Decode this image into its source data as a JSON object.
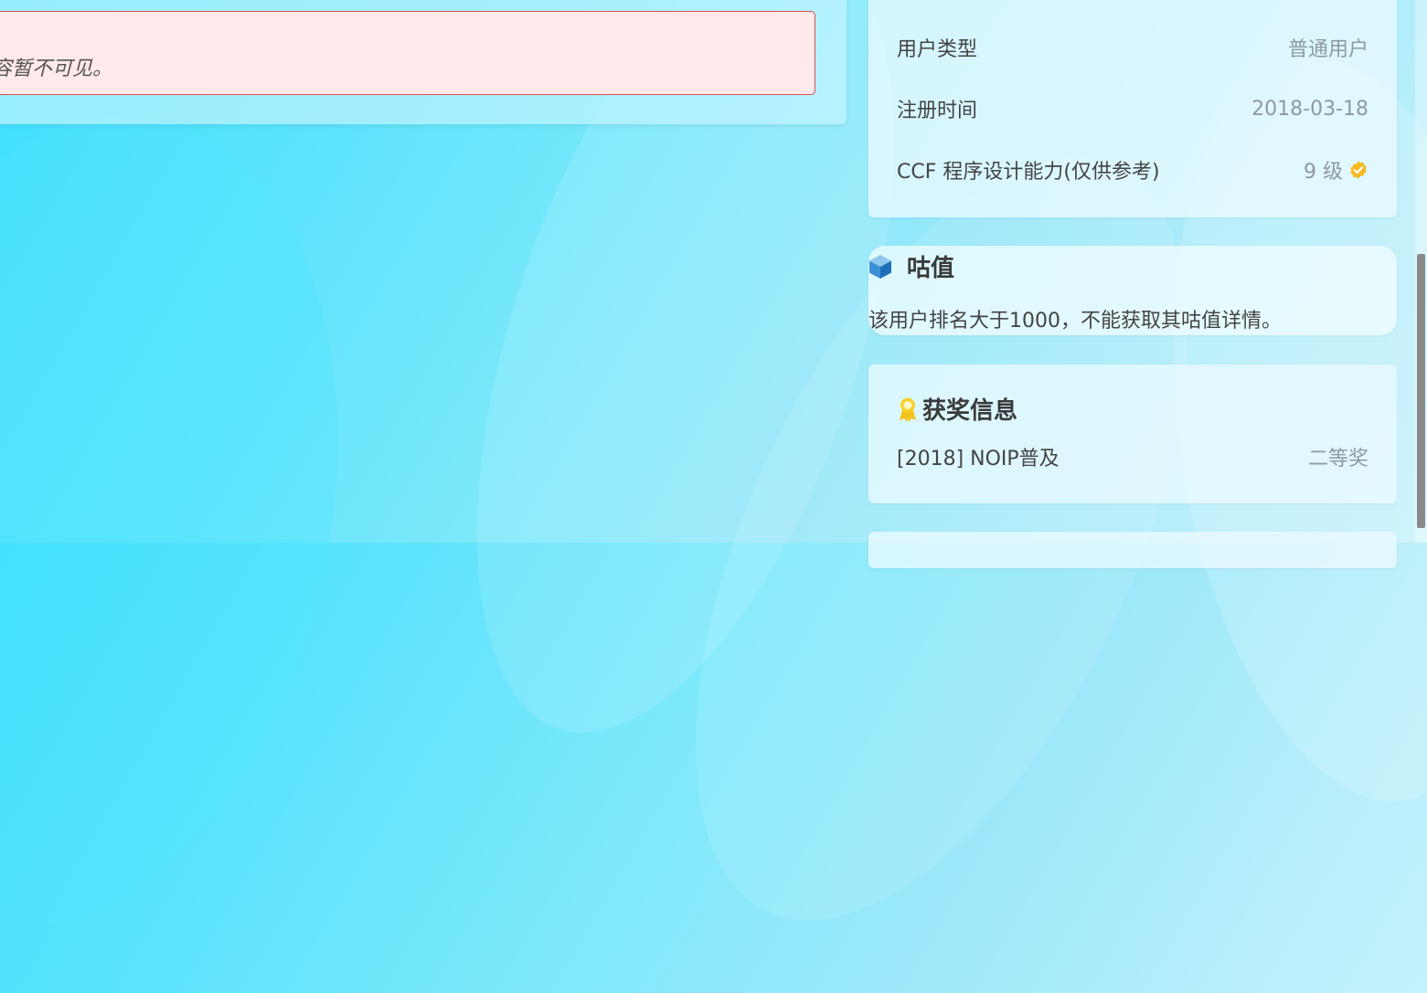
{
  "notice": {
    "text": "容暂不可见。"
  },
  "info": {
    "rows": [
      {
        "label": "用户类型",
        "value": "普通用户"
      },
      {
        "label": "注册时间",
        "value": "2018-03-18"
      },
      {
        "label": "CCF 程序设计能力(仅供参考)",
        "value": "9 级",
        "badge_color": "#f5b921"
      }
    ]
  },
  "gu": {
    "title": "咕值",
    "icon": "cube-icon",
    "text": "该用户排名大于1000，不能获取其咕值详情。"
  },
  "awards": {
    "title": "获奖信息",
    "icon": "medal-icon",
    "items": [
      {
        "label": "[2018] NOIP普及",
        "value": "二等奖"
      }
    ]
  },
  "colors": {
    "notice_border": "#d9534f",
    "notice_bg": "#ffe9ea",
    "accent_gold": "#f5b921"
  }
}
